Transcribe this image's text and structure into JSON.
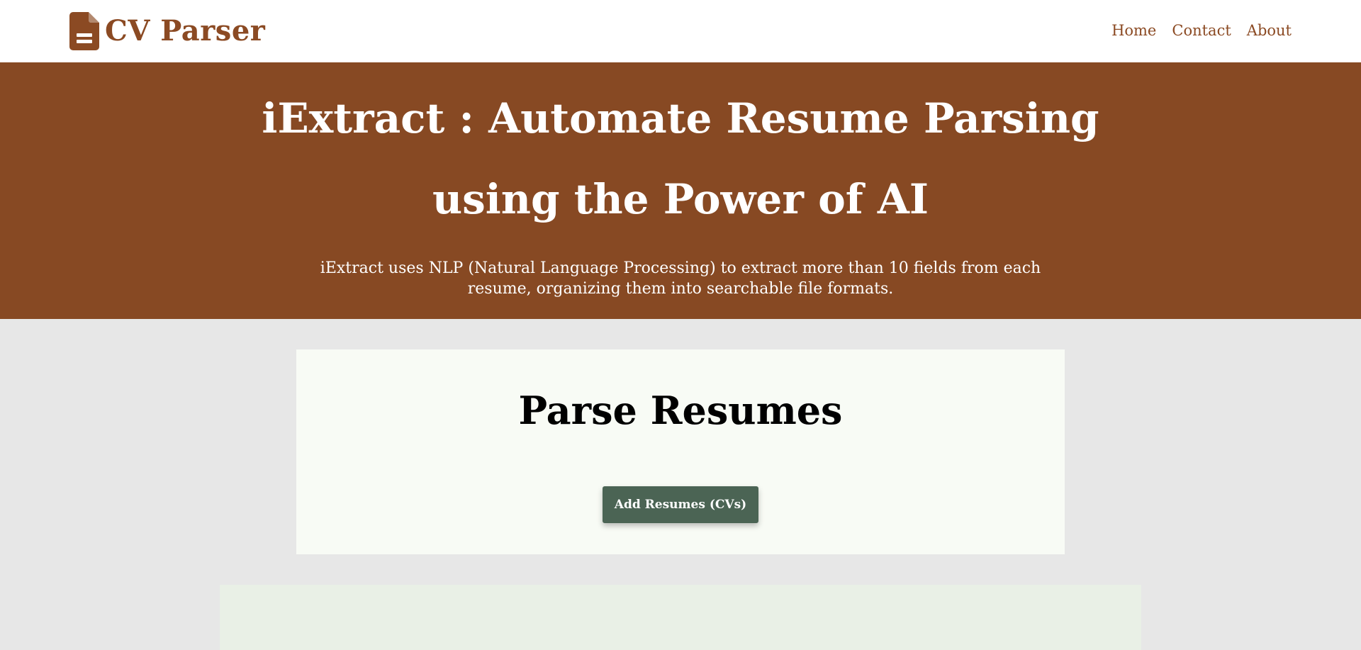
{
  "navbar": {
    "brand": {
      "icon": "document-icon",
      "text": "CV Parser"
    },
    "links": [
      {
        "label": "Home"
      },
      {
        "label": "Contact"
      },
      {
        "label": "About"
      }
    ]
  },
  "hero": {
    "title": "iExtract : Automate Resume Parsing using the Power of AI",
    "subtitle": "iExtract uses NLP (Natural Language Processing) to extract more than 10 fields from each resume, organizing them into searchable file formats."
  },
  "parse_card": {
    "title": "Parse Resumes",
    "button_label": "Add Resumes (CVs)"
  },
  "colors": {
    "brand": "#8b4a23",
    "hero_bg": "#874923",
    "page_bg": "#e7e7e7",
    "card_bg": "#f8fbf5",
    "button_bg": "#4b6454",
    "results_bg": "#e9f0e6"
  }
}
